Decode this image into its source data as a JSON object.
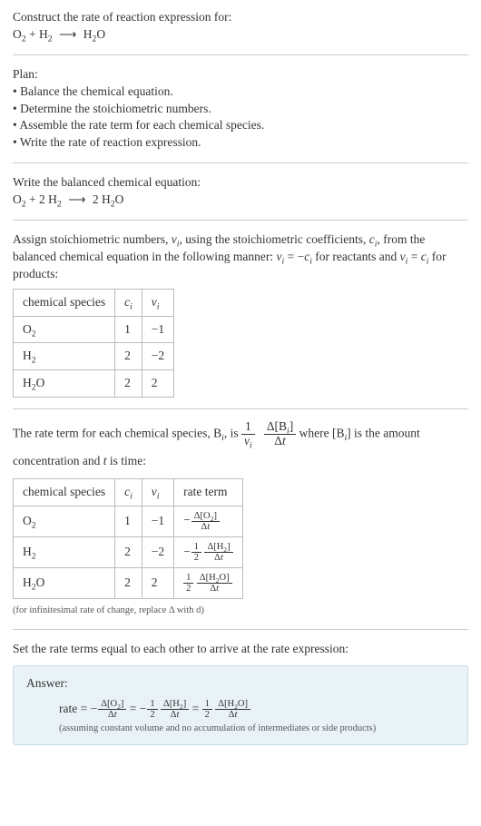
{
  "intro": {
    "line1": "Construct the rate of reaction expression for:",
    "eq_lhs": "O₂ + H₂",
    "arrow": "⟶",
    "eq_rhs": "H₂O"
  },
  "plan": {
    "title": "Plan:",
    "b1": "• Balance the chemical equation.",
    "b2": "• Determine the stoichiometric numbers.",
    "b3": "• Assemble the rate term for each chemical species.",
    "b4": "• Write the rate of reaction expression."
  },
  "balanced": {
    "title": "Write the balanced chemical equation:",
    "lhs": "O₂ + 2 H₂",
    "arrow": "⟶",
    "rhs": "2 H₂O"
  },
  "stoich": {
    "intro_a": "Assign stoichiometric numbers, ",
    "intro_b": ", using the stoichiometric coefficients, ",
    "intro_c": ", from the balanced chemical equation in the following manner: ",
    "intro_d": " for reactants and ",
    "intro_e": " for products:",
    "hdr_species": "chemical species",
    "hdr_ci": "cᵢ",
    "hdr_vi": "νᵢ",
    "r1s": "O₂",
    "r1c": "1",
    "r1v": "−1",
    "r2s": "H₂",
    "r2c": "2",
    "r2v": "−2",
    "r3s": "H₂O",
    "r3c": "2",
    "r3v": "2"
  },
  "rateterm": {
    "lead_a": "The rate term for each chemical species, ",
    "lead_b": ", is ",
    "lead_c": " where ",
    "lead_d": " is the amount concentration and ",
    "lead_e": " is time:",
    "Bi": "Bᵢ",
    "BrBi": "[Bᵢ]",
    "tvar": "t",
    "hdr_species": "chemical species",
    "hdr_ci": "cᵢ",
    "hdr_vi": "νᵢ",
    "hdr_rate": "rate term",
    "r1s": "O₂",
    "r1c": "1",
    "r1v": "−1",
    "r2s": "H₂",
    "r2c": "2",
    "r2v": "−2",
    "r3s": "H₂O",
    "r3c": "2",
    "r3v": "2",
    "footnote": "(for infinitesimal rate of change, replace Δ with d)"
  },
  "final": {
    "lead": "Set the rate terms equal to each other to arrive at the rate expression:",
    "answer_label": "Answer:",
    "rate_eq_prefix": "rate = ",
    "assumption": "(assuming constant volume and no accumulation of intermediates or side products)"
  },
  "sym": {
    "Delta": "Δ",
    "nu_i": "νᵢ",
    "c_i": "cᵢ",
    "eq1": "νᵢ = −cᵢ",
    "eq2": "νᵢ = cᵢ",
    "O2": "[O₂]",
    "H2": "[H₂]",
    "H2O": "[H₂O]",
    "half_num": "1",
    "half_den": "2",
    "one": "1"
  }
}
